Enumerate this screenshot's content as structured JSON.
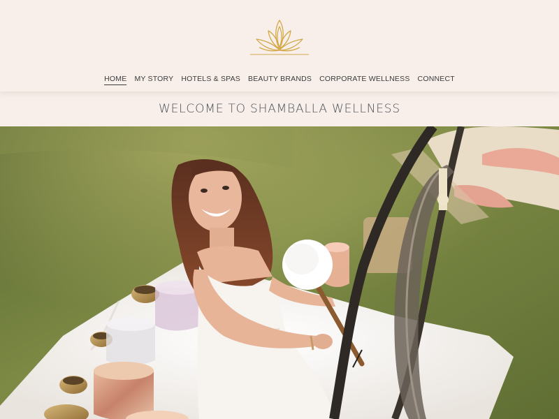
{
  "brand": {
    "logo_icon": "lotus-logo-icon",
    "logo_color": "#d4a94a"
  },
  "nav": {
    "items": [
      {
        "label": "HOME",
        "active": true
      },
      {
        "label": "MY STORY",
        "active": false
      },
      {
        "label": "HOTELS & SPAS",
        "active": false
      },
      {
        "label": "BEAUTY BRANDS",
        "active": false
      },
      {
        "label": "CORPORATE WELLNESS",
        "active": false
      },
      {
        "label": "CONNECT",
        "active": false
      }
    ]
  },
  "welcome": {
    "title": "WELCOME TO SHAMBALLA WELLNESS"
  },
  "colors": {
    "background": "#f8efea",
    "text": "#3b3b3b",
    "heading": "#4a4f56",
    "grass": "#6f7a3e"
  }
}
